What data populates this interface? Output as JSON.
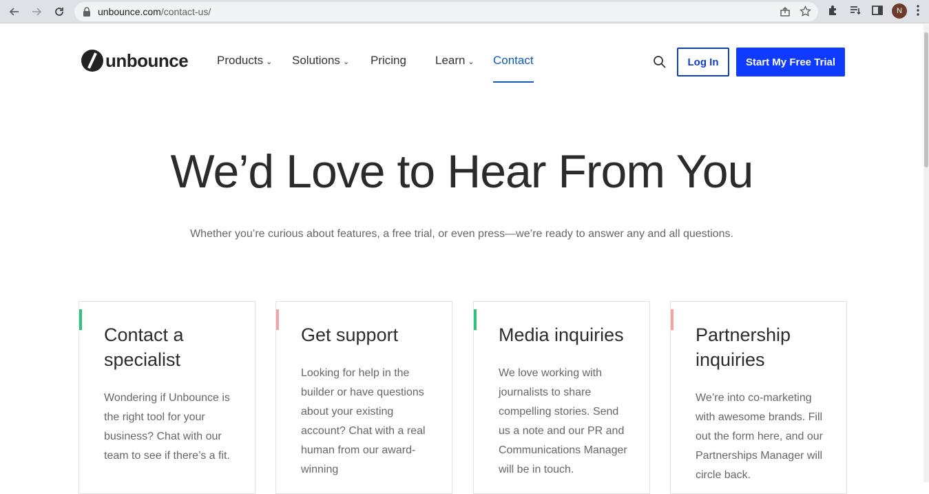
{
  "browser": {
    "url_host": "unbounce.com",
    "url_path": "/contact-us/",
    "profile_initial": "N"
  },
  "site": {
    "logo_text": "unbounce",
    "nav": [
      {
        "label": "Products",
        "has_dropdown": true
      },
      {
        "label": "Solutions",
        "has_dropdown": true
      },
      {
        "label": "Pricing",
        "has_dropdown": false
      },
      {
        "label": "Learn",
        "has_dropdown": true
      },
      {
        "label": "Contact",
        "has_dropdown": false,
        "active": true
      }
    ],
    "login_label": "Log In",
    "trial_label": "Start My Free Trial",
    "colors": {
      "accent_blue": "#0e3bff",
      "active_link": "#0e5ab7",
      "green": "#2ec27e",
      "pink": "#f2a3a3"
    }
  },
  "hero": {
    "title": "We’d Love to Hear From You",
    "subtitle": "Whether you’re curious about features, a free trial, or even press—we’re ready to answer any and all questions."
  },
  "cards": [
    {
      "title": "Contact a specialist",
      "body": "Wondering if Unbounce is the right tool for your business? Chat with our team to see if there’s a fit.",
      "accent": "#2ec27e"
    },
    {
      "title": "Get support",
      "body": "Looking for help in the builder or have questions about your existing account? Chat with a real human from our award-winning",
      "accent": "#f2a3a3"
    },
    {
      "title": "Media inquiries",
      "body": "We love working with journalists to share compelling stories. Send us a note and our PR and Communications Manager will be in touch.",
      "accent": "#2ec27e"
    },
    {
      "title": "Partnership inquiries",
      "body": "We’re into co-marketing with awesome brands. Fill out the form here, and our Partnerships Manager will circle back.",
      "accent": "#f2a3a3"
    }
  ]
}
